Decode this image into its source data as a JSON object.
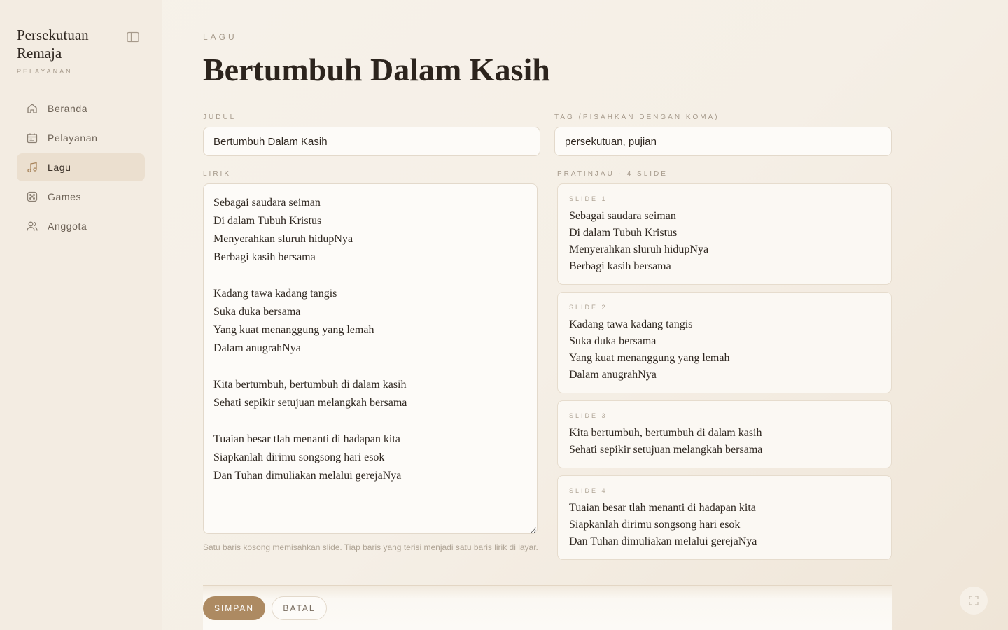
{
  "sidebar": {
    "brand_title": "Persekutuan Remaja",
    "brand_subtitle": "PELAYANAN",
    "items": [
      {
        "label": "Beranda",
        "icon": "home-icon"
      },
      {
        "label": "Pelayanan",
        "icon": "calendar-icon"
      },
      {
        "label": "Lagu",
        "icon": "music-note-icon",
        "active": true
      },
      {
        "label": "Games",
        "icon": "dice-icon"
      },
      {
        "label": "Anggota",
        "icon": "users-icon"
      }
    ]
  },
  "page": {
    "eyebrow": "LAGU",
    "title": "Bertumbuh Dalam Kasih"
  },
  "form": {
    "title_label": "JUDUL",
    "title_value": "Bertumbuh Dalam Kasih",
    "tags_label": "TAG (PISAHKAN DENGAN KOMA)",
    "tags_value": "persekutuan, pujian",
    "lyrics_label": "LIRIK",
    "lyrics_value": "Sebagai saudara seiman\nDi dalam Tubuh Kristus\nMenyerahkan sluruh hidupNya\nBerbagi kasih bersama\n\nKadang tawa kadang tangis\nSuka duka bersama\nYang kuat menanggung yang lemah\nDalam anugrahNya\n\nKita bertumbuh, bertumbuh di dalam kasih\nSehati sepikir setujuan melangkah bersama\n\nTuaian besar tlah menanti di hadapan kita\nSiapkanlah dirimu songsong hari esok\nDan Tuhan dimuliakan melalui gerejaNya",
    "hint": "Satu baris kosong memisahkan slide. Tiap baris yang terisi menjadi satu baris lirik di layar."
  },
  "preview": {
    "label": "PRATINJAU · 4 SLIDE",
    "slides": [
      {
        "label": "SLIDE 1",
        "lines": [
          "Sebagai saudara seiman",
          "Di dalam Tubuh Kristus",
          "Menyerahkan sluruh hidupNya",
          "Berbagi kasih bersama"
        ]
      },
      {
        "label": "SLIDE 2",
        "lines": [
          "Kadang tawa kadang tangis",
          "Suka duka bersama",
          "Yang kuat menanggung yang lemah",
          "Dalam anugrahNya"
        ]
      },
      {
        "label": "SLIDE 3",
        "lines": [
          "Kita bertumbuh, bertumbuh di dalam kasih",
          "Sehati sepikir setujuan melangkah bersama"
        ]
      },
      {
        "label": "SLIDE 4",
        "lines": [
          "Tuaian besar tlah menanti di hadapan kita",
          "Siapkanlah dirimu songsong hari esok",
          "Dan Tuhan dimuliakan melalui gerejaNya"
        ]
      }
    ]
  },
  "actions": {
    "save_label": "SIMPAN",
    "cancel_label": "BATAL"
  },
  "colors": {
    "accent": "#ad8a62",
    "background": "#f7f2ea",
    "sidebar": "#f3ece2",
    "active_nav": "#ebdfcf"
  }
}
